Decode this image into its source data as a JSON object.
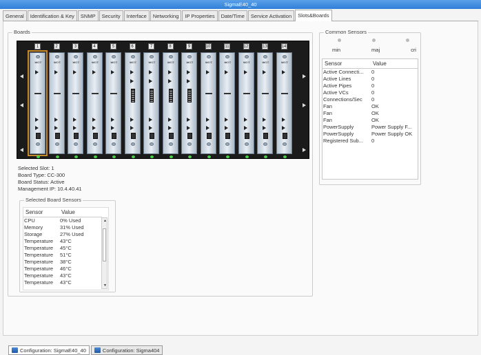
{
  "window": {
    "title": "SigmaE40_40"
  },
  "tabs": [
    {
      "label": "General"
    },
    {
      "label": "Identification & Key"
    },
    {
      "label": "SNMP"
    },
    {
      "label": "Security"
    },
    {
      "label": "Interface"
    },
    {
      "label": "Networking"
    },
    {
      "label": "IP Properties"
    },
    {
      "label": "Date/Time"
    },
    {
      "label": "Service Activation"
    },
    {
      "label": "Slots&Boards",
      "active": true
    }
  ],
  "boards": {
    "title": "Boards",
    "slots": [
      "1",
      "2",
      "3",
      "4",
      "5",
      "6",
      "7",
      "8",
      "9",
      "10",
      "11",
      "12",
      "13",
      "14"
    ],
    "selected_slot_index": 0,
    "card_mark": "₩Ω∓",
    "info": {
      "selected_slot": "Selected Slot: 1",
      "board_type": "Board Type: CC-300",
      "board_status": "Board Status: Active",
      "management_ip": "Management IP: 10.4.40.41"
    }
  },
  "selected_board_sensors": {
    "title": "Selected Board Sensors",
    "headers": [
      "Sensor",
      "Value"
    ],
    "rows": [
      {
        "sensor": "CPU",
        "value": "0% Used"
      },
      {
        "sensor": "Memory",
        "value": "31% Used"
      },
      {
        "sensor": "Storage",
        "value": "27% Used"
      },
      {
        "sensor": "Temperature",
        "value": "43°C"
      },
      {
        "sensor": "Temperature",
        "value": "45°C"
      },
      {
        "sensor": "Temperature",
        "value": "51°C"
      },
      {
        "sensor": "Temperature",
        "value": "38°C"
      },
      {
        "sensor": "Temperature",
        "value": "46°C"
      },
      {
        "sensor": "Temperature",
        "value": "43°C"
      },
      {
        "sensor": "Temperature",
        "value": "43°C"
      }
    ]
  },
  "common_sensors": {
    "title": "Common Sensors",
    "alarms": [
      "min",
      "maj",
      "cri"
    ],
    "headers": [
      "Sensor",
      "Value"
    ],
    "rows": [
      {
        "sensor": "Active Connecti...",
        "value": "0"
      },
      {
        "sensor": "Active Lines",
        "value": "0"
      },
      {
        "sensor": "Active Pipes",
        "value": "0"
      },
      {
        "sensor": "Active VCs",
        "value": "0"
      },
      {
        "sensor": "Connections/Sec",
        "value": "0"
      },
      {
        "sensor": "Fan",
        "value": "OK"
      },
      {
        "sensor": "Fan",
        "value": "OK"
      },
      {
        "sensor": "Fan",
        "value": "OK"
      },
      {
        "sensor": "PowerSupply",
        "value": "Power Supply F..."
      },
      {
        "sensor": "PowerSupply",
        "value": "Power Supply OK"
      },
      {
        "sensor": "Registered Sub...",
        "value": "0"
      }
    ]
  },
  "bottom_tabs": [
    {
      "label": "Configuration: SigmaE40_40",
      "active": true
    },
    {
      "label": "Configuration: Sigma404",
      "active": false
    }
  ]
}
